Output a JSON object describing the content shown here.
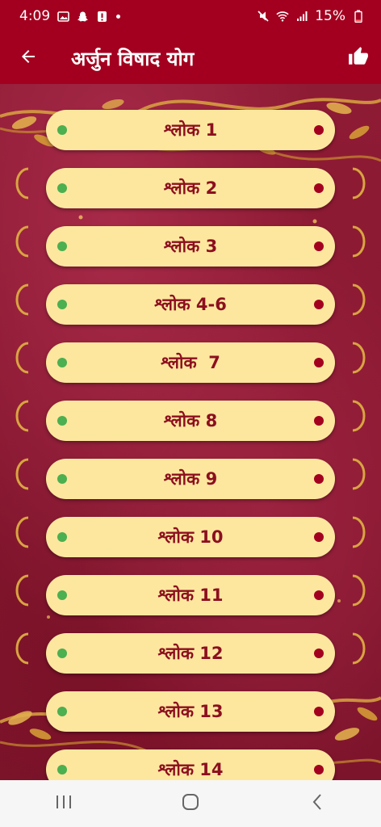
{
  "status": {
    "time": "4:09",
    "battery": "15%",
    "left_icons": [
      "gallery-icon",
      "snapchat-icon",
      "alert-icon",
      "dot-icon"
    ],
    "right_icons": [
      "mute-icon",
      "wifi-icon",
      "signal-icon",
      "battery-icon"
    ]
  },
  "appbar": {
    "title": "अर्जुन विषाद योग",
    "back_icon": "arrow-left-icon",
    "like_icon": "thumbs-up-icon"
  },
  "shloks": [
    {
      "label": "श्लोक 1"
    },
    {
      "label": "श्लोक 2"
    },
    {
      "label": "श्लोक 3"
    },
    {
      "label": "श्लोक 4-6"
    },
    {
      "label": "श्लोक  7"
    },
    {
      "label": "श्लोक 8"
    },
    {
      "label": "श्लोक 9"
    },
    {
      "label": "श्लोक 10"
    },
    {
      "label": "श्लोक 11"
    },
    {
      "label": "श्लोक 12"
    },
    {
      "label": "श्लोक 13"
    },
    {
      "label": "श्लोक 14"
    }
  ],
  "navbar": {
    "icons": [
      "recent-apps-icon",
      "home-icon",
      "back-icon"
    ]
  },
  "colors": {
    "header": "#a3001f",
    "pill": "#fde79f",
    "pill_text": "#8c0f1f",
    "dot_left": "#4caf50",
    "dot_right": "#a3001f"
  }
}
